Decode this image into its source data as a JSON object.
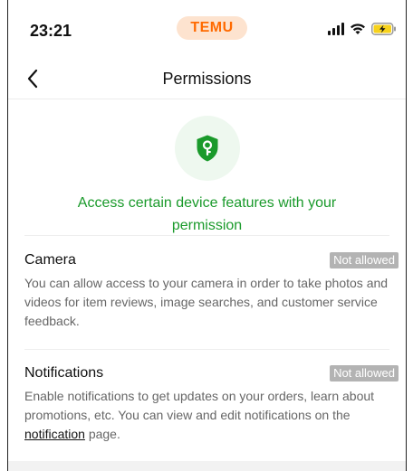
{
  "status_bar": {
    "time": "23:21",
    "app_badge": "TEMU"
  },
  "nav": {
    "title": "Permissions"
  },
  "hero": {
    "text": "Access certain device features with your permission"
  },
  "permissions": [
    {
      "title": "Camera",
      "status": "Not allowed",
      "description": "You can allow access to your camera in order to take photos and videos for item reviews, image searches, and customer service feedback."
    },
    {
      "title": "Notifications",
      "status": "Not allowed",
      "description_before": "Enable notifications to get updates on your orders, learn about promotions, etc. You can view and edit notifications on the ",
      "link": "notification",
      "description_after": " page."
    }
  ],
  "colors": {
    "accent_green": "#1a9a2b",
    "brand_orange": "#ff6a00",
    "badge_gray": "#b3b3b3"
  },
  "icons": [
    "back-chevron-icon",
    "shield-key-icon",
    "cellular-signal-icon",
    "wifi-icon",
    "battery-charging-icon"
  ]
}
